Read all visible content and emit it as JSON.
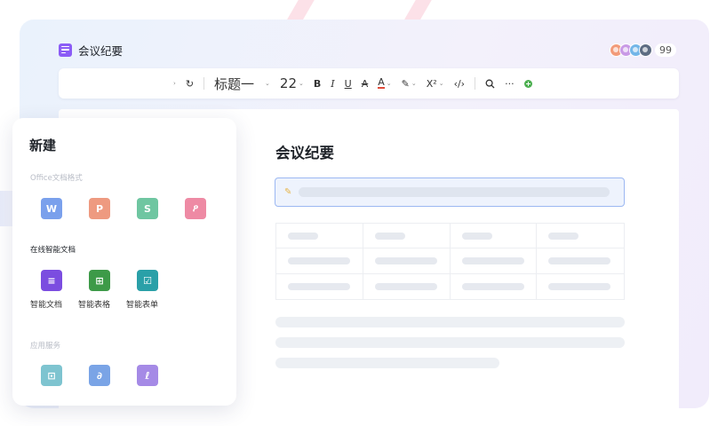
{
  "doc": {
    "title": "会议纪要"
  },
  "collaborators": {
    "count": "99",
    "avatar_colors": [
      "#f29b7a",
      "#c99ae6",
      "#73b6e8",
      "#5d6c82"
    ]
  },
  "toolbar": {
    "redo_icon": "↻",
    "heading": "标题一",
    "font_size": "22",
    "bold": "B",
    "italic": "I",
    "underline": "U",
    "strike": "A",
    "font_color": "A",
    "highlight": "✎",
    "superscript": "X²",
    "code": "‹/›",
    "more": "···"
  },
  "paper": {
    "title": "会议纪要"
  },
  "new_panel": {
    "title": "新建",
    "office_section": "Office文档格式",
    "office_items": [
      {
        "glyph": "W",
        "color": "#7aa0ec"
      },
      {
        "glyph": "P",
        "color": "#ee9a80"
      },
      {
        "glyph": "S",
        "color": "#6fc6a1"
      },
      {
        "glyph": "ዖ",
        "color": "#ee8aa4"
      }
    ],
    "smart_section": "在线智能文档",
    "smart_items": [
      {
        "label": "智能文档",
        "glyph": "≡",
        "color": "#7b4de0"
      },
      {
        "label": "智能表格",
        "glyph": "⊞",
        "color": "#3d9a48"
      },
      {
        "label": "智能表单",
        "glyph": "☑",
        "color": "#2aa0a8"
      }
    ],
    "app_section": "应用服务",
    "app_items": [
      {
        "glyph": "⊡",
        "color": "#7ec4d0"
      },
      {
        "glyph": "∂",
        "color": "#7aa4e6"
      },
      {
        "glyph": "ℓ",
        "color": "#a58ae6"
      }
    ]
  }
}
